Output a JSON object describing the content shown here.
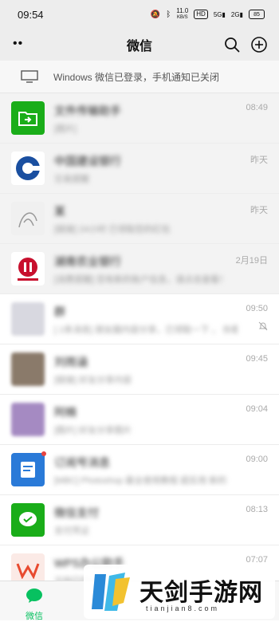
{
  "status": {
    "time": "09:54",
    "speed_value": "11.0",
    "speed_unit": "KB/S",
    "hd": "HD",
    "net1": "5G",
    "net2": "2G",
    "battery": "85"
  },
  "header": {
    "title": "微信",
    "more_icon": "more-dots-icon",
    "search_icon": "search-icon",
    "add_icon": "plus-circle-icon"
  },
  "notice": {
    "text": "Windows 微信已登录，手机通知已关闭",
    "icon": "monitor-icon"
  },
  "chats": [
    {
      "name": "文件传输助手",
      "snippet": "[图片]",
      "time": "08:49",
      "pinned": true,
      "avatar_color": "#1aad19"
    },
    {
      "name": "中国建设银行",
      "snippet": "交易提醒",
      "time": "昨天",
      "pinned": true,
      "avatar_color": "#1a4fa0"
    },
    {
      "name": "某",
      "snippet": "[链接] 24小时 已领取您的红包",
      "time": "昨天",
      "pinned": true,
      "avatar_color": "#dddddd"
    },
    {
      "name": "湖南农业银行",
      "snippet": "[消费提醒] 您有新的账户信息，请点击查看！",
      "time": "2月19日",
      "pinned": true,
      "avatar_color": "#c8102e"
    },
    {
      "name": "群",
      "snippet": "[ 1条消息]  朋友圈内容分享，已领取一下 ， 你看一下...",
      "time": "09:50",
      "pinned": false,
      "muted": true,
      "avatar_color": "#d8d8e0"
    },
    {
      "name": "刘雨涵",
      "snippet": "[链接] 好友分享内容",
      "time": "09:45",
      "pinned": false,
      "avatar_color": "#8a7a6a"
    },
    {
      "name": "阿楠",
      "snippet": "[图片] 好友分享图片",
      "time": "09:04",
      "pinned": false,
      "avatar_color": "#a58ac2"
    },
    {
      "name": "订阅号消息",
      "snippet": "[MBC] Photoshop 最全使用教程 超实用 新的",
      "time": "09:00",
      "pinned": false,
      "avatar_color": "#2a7ad8"
    },
    {
      "name": "微信支付",
      "snippet": "支付凭证",
      "time": "08:13",
      "pinned": false,
      "avatar_color": "#1aad19"
    },
    {
      "name": "WPS办公助手",
      "snippet": "文档已同步",
      "time": "07:07",
      "pinned": false,
      "avatar_color": "#e84a2f"
    }
  ],
  "tabbar": {
    "chats_label": "微信",
    "chats_icon": "chat-bubble-icon"
  },
  "watermark": {
    "cn": "天剑手游网",
    "en": "tianjian8.com"
  }
}
